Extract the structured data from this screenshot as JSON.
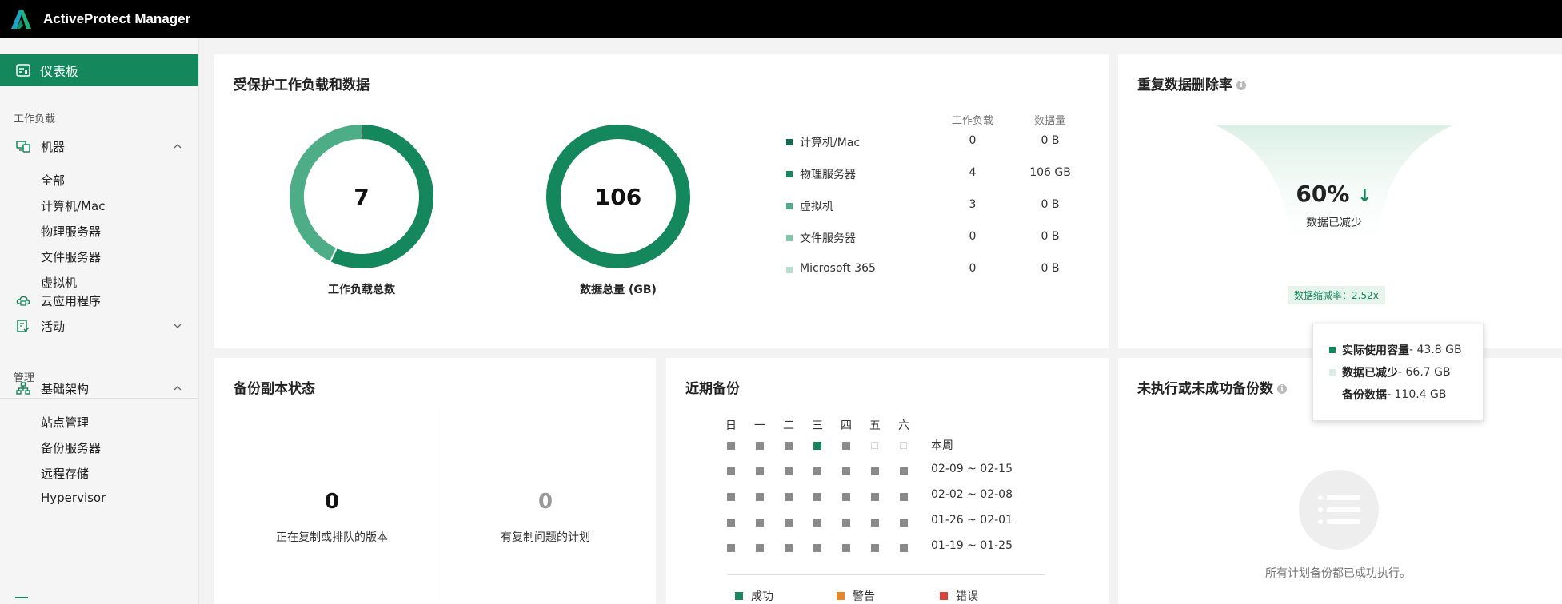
{
  "app": {
    "title": "ActiveProtect Manager"
  },
  "colors": {
    "brand": "#15875c",
    "success": "#15875c",
    "warning": "#e8862a",
    "error": "#d9413a",
    "inactive": "#8a8a8a"
  },
  "sidebar": {
    "active": {
      "label": "仪表板",
      "icon": "dashboard-icon"
    },
    "sections": [
      {
        "label": "工作负载"
      },
      {
        "label": "管理"
      }
    ],
    "machines": {
      "label": "机器",
      "icon": "machines-icon",
      "children": [
        "全部",
        "计算机/Mac",
        "物理服务器",
        "文件服务器",
        "虚拟机"
      ]
    },
    "cloud_apps": {
      "label": "云应用程序",
      "icon": "cloud-icon"
    },
    "activity": {
      "label": "活动",
      "icon": "activity-icon"
    },
    "infrastructure": {
      "label": "基础架构",
      "icon": "infrastructure-icon",
      "children": [
        "站点管理",
        "备份服务器",
        "远程存储",
        "Hypervisor"
      ]
    }
  },
  "protected": {
    "title": "受保护工作负载和数据",
    "workloads_total": {
      "value": "7",
      "label": "工作负载总数"
    },
    "data_total": {
      "value": "106",
      "label": "数据总量 (GB)"
    },
    "columns": {
      "workload": "工作负载",
      "data": "数据量"
    },
    "rows": [
      {
        "name": "计算机/Mac",
        "workload": "0",
        "data": "0 B",
        "color": "#0d6b49"
      },
      {
        "name": "物理服务器",
        "workload": "4",
        "data": "106 GB",
        "color": "#15875c"
      },
      {
        "name": "虚拟机",
        "workload": "3",
        "data": "0 B",
        "color": "#4cad86"
      },
      {
        "name": "文件服务器",
        "workload": "0",
        "data": "0 B",
        "color": "#7fc6a7"
      },
      {
        "name": "Microsoft 365",
        "workload": "0",
        "data": "0 B",
        "color": "#b5dfcb"
      }
    ],
    "donut_workload_shares": [
      {
        "type": "物理服务器",
        "count": 4,
        "color": "#15875c"
      },
      {
        "type": "虚拟机",
        "count": 3,
        "color": "#4cad86"
      }
    ],
    "donut_data_shares": [
      {
        "type": "物理服务器",
        "gb": 106,
        "color": "#15875c"
      }
    ]
  },
  "dedup": {
    "title": "重复数据删除率",
    "percent": "60%",
    "subtitle": "数据已减少",
    "ratio": "数据缩减率：2.52x",
    "tooltip": [
      {
        "label": "实际使用容量",
        "value": " - 43.8 GB",
        "color": "#15875c"
      },
      {
        "label": "数据已减少",
        "value": " - 66.7 GB",
        "color": "#dbeee5"
      },
      {
        "label": "备份数据",
        "value": " - 110.4 GB",
        "color": ""
      }
    ]
  },
  "replication": {
    "title": "备份副本状态",
    "left": {
      "value": "0",
      "label": "正在复制或排队的版本"
    },
    "right": {
      "value": "0",
      "label": "有复制问题的计划"
    }
  },
  "recent": {
    "title": "近期备份",
    "days": [
      "日",
      "一",
      "二",
      "三",
      "四",
      "五",
      "六"
    ],
    "weeks": [
      {
        "label": "本周",
        "cells": [
          "gray",
          "gray",
          "gray",
          "success",
          "gray",
          "empty",
          "empty"
        ]
      },
      {
        "label": "02-09 ~ 02-15",
        "cells": [
          "gray",
          "gray",
          "gray",
          "gray",
          "gray",
          "gray",
          "gray"
        ]
      },
      {
        "label": "02-02 ~ 02-08",
        "cells": [
          "gray",
          "gray",
          "gray",
          "gray",
          "gray",
          "gray",
          "gray"
        ]
      },
      {
        "label": "01-26 ~ 02-01",
        "cells": [
          "gray",
          "gray",
          "gray",
          "gray",
          "gray",
          "gray",
          "gray"
        ]
      },
      {
        "label": "01-19 ~ 01-25",
        "cells": [
          "gray",
          "gray",
          "gray",
          "gray",
          "gray",
          "gray",
          "gray"
        ]
      }
    ],
    "legend": {
      "success": "成功",
      "warning": "警告",
      "error": "错误"
    }
  },
  "failed": {
    "title": "未执行或未成功备份数",
    "empty_text": "所有计划备份都已成功执行。"
  }
}
